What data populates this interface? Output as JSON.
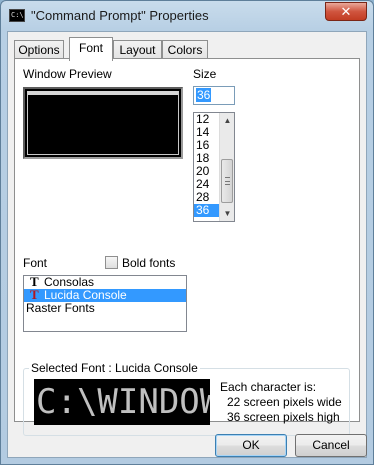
{
  "window": {
    "title": "\"Command Prompt\" Properties",
    "icon_name": "console-window-icon",
    "close_glyph": "✕"
  },
  "tabs": [
    {
      "label": "Options",
      "active": false
    },
    {
      "label": "Font",
      "active": true
    },
    {
      "label": "Layout",
      "active": false
    },
    {
      "label": "Colors",
      "active": false
    }
  ],
  "window_preview": {
    "label": "Window Preview"
  },
  "size": {
    "label": "Size",
    "input_value": "36",
    "options": [
      "12",
      "14",
      "16",
      "18",
      "20",
      "24",
      "28",
      "36"
    ],
    "selected": "36"
  },
  "font": {
    "label": "Font",
    "bold_label": "Bold fonts",
    "bold_checked": false,
    "items": [
      {
        "name": "Consolas",
        "icon": "truetype-font-icon"
      },
      {
        "name": "Lucida Console",
        "icon": "truetype-font-icon",
        "selected": true
      },
      {
        "name": "Raster Fonts",
        "icon": ""
      }
    ]
  },
  "selected_font": {
    "group_label": "Selected Font : Lucida Console",
    "sample_text": "C:\\WINDOWS",
    "char_heading": "Each character is:",
    "width_line": "22 screen pixels wide",
    "height_line": "36 screen pixels high"
  },
  "buttons": {
    "ok": "OK",
    "cancel": "Cancel"
  },
  "colors": {
    "selection": "#3399ff",
    "titlebar": "#b9d1e6",
    "close": "#c94a32"
  }
}
